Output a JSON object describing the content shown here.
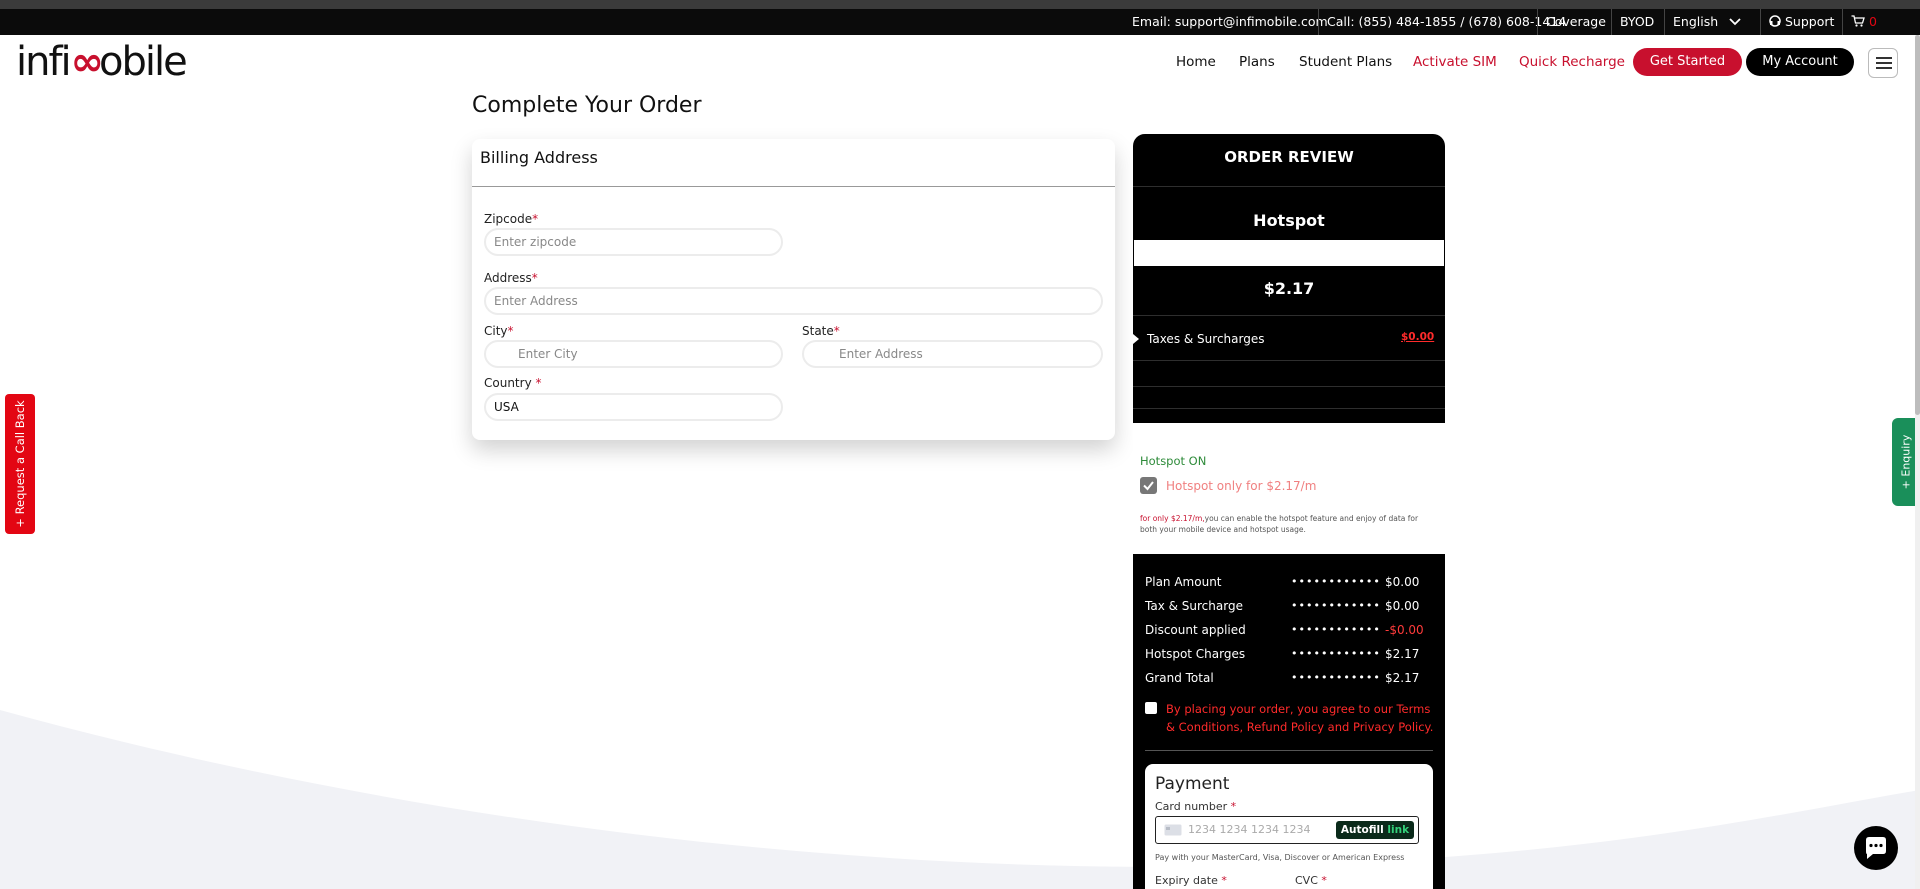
{
  "topbar": {
    "email": "Email: support@infimobile.com",
    "call": "Call: (855) 484-1855 / (678) 608-1414",
    "coverage": "Coverage",
    "byod": "BYOD",
    "language": "English",
    "support": "Support",
    "cart_count": "0"
  },
  "brand": {
    "logo_left": "infi",
    "logo_mid": "∞",
    "logo_right": "obile",
    "accent": "#c8102e"
  },
  "nav": {
    "home": "Home",
    "plans": "Plans",
    "student_plans": "Student Plans",
    "activate_sim": "Activate SIM",
    "quick_recharge": "Quick Recharge",
    "get_started": "Get Started",
    "my_account": "My Account"
  },
  "page": {
    "title": "Complete Your Order"
  },
  "billing": {
    "heading": "Billing Address",
    "zipcode_label": "Zipcode",
    "zipcode_placeholder": "Enter zipcode",
    "address_label": "Address",
    "address_placeholder": "Enter Address",
    "city_label": "City",
    "city_placeholder": "Enter City",
    "state_label": "State",
    "state_placeholder": "Enter Address",
    "country_label": "Country",
    "country_value": "USA",
    "required_mark": "*"
  },
  "order_review": {
    "heading": "ORDER REVIEW",
    "plan_name": "Hotspot",
    "price": "$2.17",
    "taxes_label": "Taxes & Surcharges",
    "taxes_value": "$0.00",
    "hotspot_status": "Hotspot ON",
    "hotspot_option": "Hotspot only for $2.17/m",
    "hotspot_note_strong": "for only $2.17/m,",
    "hotspot_note": "you can enable the hotspot feature and enjoy of data for both your mobile device and hotspot usage.",
    "summary": [
      {
        "label": "Plan Amount",
        "value": "$0.00"
      },
      {
        "label": "Tax & Surcharge",
        "value": "$0.00"
      },
      {
        "label": "Discount applied",
        "value": "-$0.00"
      },
      {
        "label": "Hotspot Charges",
        "value": "$2.17"
      },
      {
        "label": "Grand Total",
        "value": "$2.17"
      }
    ],
    "dots": "••••••••••••",
    "terms": "By placing your order, you agree to our Terms & Conditions, Refund Policy and Privacy Policy."
  },
  "payment": {
    "heading": "Payment",
    "card_label": "Card number",
    "card_placeholder": "1234 1234 1234 1234",
    "autofill": "Autofill",
    "link": "link",
    "note": "Pay with your MasterCard, Visa, Discover or American Express",
    "expiry_label": "Expiry date",
    "cvc_label": "CVC"
  },
  "side": {
    "call_back": "+ Request a Call Back",
    "enquiry": "+ Enquiry"
  }
}
